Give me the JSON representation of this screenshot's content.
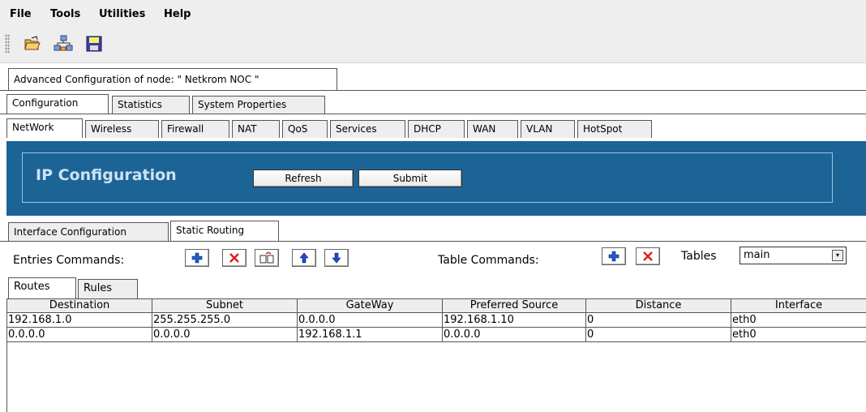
{
  "menu": [
    "File",
    "Tools",
    "Utilities",
    "Help"
  ],
  "toolbar": {
    "open_icon": "open-folder-icon",
    "network_icon": "network-icon",
    "save_icon": "save-disk-icon"
  },
  "node_tab": "Advanced Configuration of node:  \" Netkrom NOC \"",
  "main_tabs": [
    "Configuration",
    "Statistics",
    "System Properties"
  ],
  "section_tabs": [
    "NetWork",
    "Wireless",
    "Firewall",
    "NAT",
    "QoS",
    "Services",
    "DHCP",
    "WAN",
    "VLAN",
    "HotSpot"
  ],
  "banner": {
    "title": "IP Configuration",
    "refresh_label": "Refresh",
    "submit_label": "Submit",
    "color": "#1c6496"
  },
  "sub_tabs": [
    "Interface Configuration",
    "Static Routing"
  ],
  "commands": {
    "entries_label": "Entries Commands:",
    "table_label": "Table Commands:",
    "tables_label": "Tables",
    "tables_value": "main"
  },
  "route_tabs": [
    "Routes",
    "Rules"
  ],
  "table": {
    "columns": [
      "Destination",
      "Subnet",
      "GateWay",
      "Preferred Source",
      "Distance",
      "Interface"
    ],
    "rows": [
      [
        "192.168.1.0",
        "255.255.255.0",
        "0.0.0.0",
        "192.168.1.10",
        "0",
        "eth0"
      ],
      [
        "0.0.0.0",
        "0.0.0.0",
        "192.168.1.1",
        "0.0.0.0",
        "0",
        "eth0"
      ]
    ]
  }
}
